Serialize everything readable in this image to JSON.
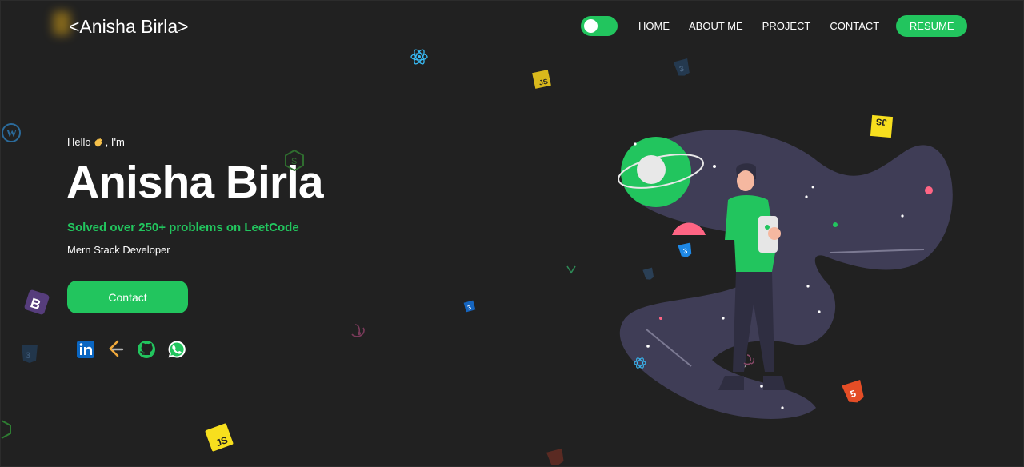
{
  "header": {
    "logo_text": "<Anisha Birla>",
    "nav": [
      {
        "label": "HOME"
      },
      {
        "label": "ABOUT ME"
      },
      {
        "label": "PROJECT"
      },
      {
        "label": "CONTACT"
      }
    ],
    "resume_label": "RESUME",
    "theme_toggle_on": true
  },
  "hero": {
    "greeting_before": "Hello ",
    "greeting_after": ", I'm",
    "name": "Anisha Birla",
    "tagline": "Solved over 250+ problems on LeetCode",
    "role": "Mern Stack Developer",
    "contact_label": "Contact"
  },
  "social": [
    {
      "icon": "linkedin-icon"
    },
    {
      "icon": "leetcode-icon"
    },
    {
      "icon": "github-icon"
    },
    {
      "icon": "whatsapp-icon"
    }
  ],
  "floating_badges": {
    "js": "JS"
  },
  "colors": {
    "background": "#212121",
    "accent": "#22c55e",
    "illustration_blob": "#3f3d56",
    "pink": "#ff6584"
  }
}
